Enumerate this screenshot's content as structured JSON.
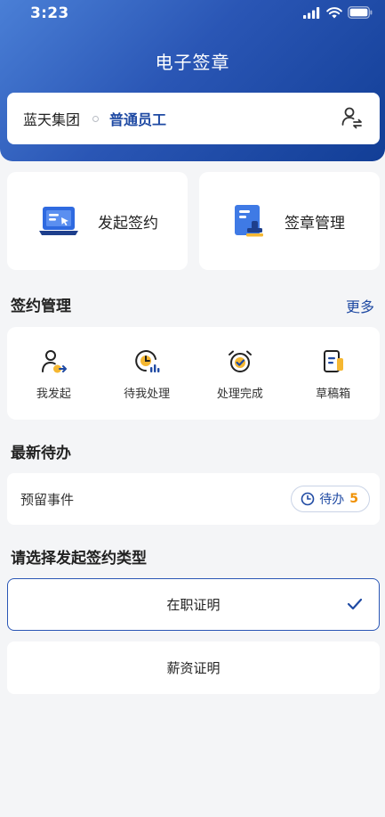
{
  "status": {
    "time": "3:23"
  },
  "header": {
    "title": "电子签章"
  },
  "org": {
    "name": "蓝天集团",
    "role": "普通员工"
  },
  "quick_actions": [
    {
      "label": "发起签约",
      "icon": "laptop-sign-icon"
    },
    {
      "label": "签章管理",
      "icon": "seal-document-icon"
    }
  ],
  "sign_management": {
    "title": "签约管理",
    "more": "更多",
    "items": [
      {
        "label": "我发起",
        "icon": "user-send-icon"
      },
      {
        "label": "待我处理",
        "icon": "clock-chart-icon"
      },
      {
        "label": "处理完成",
        "icon": "alarm-check-icon"
      },
      {
        "label": "草稿箱",
        "icon": "draft-document-icon"
      }
    ]
  },
  "latest_todo": {
    "title": "最新待办",
    "item": {
      "name": "预留事件",
      "badge_label": "待办",
      "badge_count": "5"
    }
  },
  "sign_type": {
    "title": "请选择发起签约类型",
    "options": [
      {
        "label": "在职证明",
        "selected": true
      },
      {
        "label": "薪资证明",
        "selected": false
      }
    ]
  },
  "colors": {
    "primary": "#1f4aa3",
    "header_gradient_start": "#4a7fd6",
    "header_gradient_end": "#123e96",
    "badge_count": "#f09000",
    "icon_accent": "#f5b731"
  }
}
